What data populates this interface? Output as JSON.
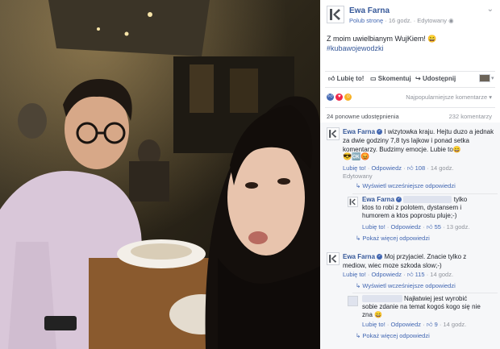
{
  "post": {
    "page_name": "Ewa Farna",
    "follow_label": "Polub stronę",
    "time": "16 godz.",
    "edited": "Edytowany",
    "text": "Z moim uwielbianym WujKiem! 😄",
    "hashtag": "#kubawojewodzki"
  },
  "actions": {
    "like": "Lubię to!",
    "comment": "Skomentuj",
    "share": "Udostępnij"
  },
  "reactions": {
    "sort_label": "Najpopularniejsze komentarze",
    "shares": "24 ponowne udostępnienia",
    "comments_count": "232 komentarzy"
  },
  "comments": [
    {
      "author": "Ewa Farna",
      "text": "I wizytowka kraju. Hejtu duzo a jednak za dwie godziny 7,8 tys lajkow i ponad setka komentarzy. Budzimy emocje. Lubie to😄",
      "emoji_line": "😎🆗😡",
      "like": "Lubię to!",
      "reply": "Odpowiedz",
      "likes": "108",
      "time": "14 godz.",
      "edited": "Edytowany",
      "show_previous": "Wyświetl wcześniejsze odpowiedzi",
      "reply_item": {
        "author": "Ewa Farna",
        "text": "tylko ktos to robi z polotem, dystansem i humorem a ktos poprostu pluje;-)",
        "like": "Lubię to!",
        "reply": "Odpowiedz",
        "likes": "55",
        "time": "13 godz."
      },
      "show_more": "Pokaż więcej odpowiedzi"
    },
    {
      "author": "Ewa Farna",
      "text": "Moj przyjaciel. Znacie tylko z mediow, wiec moze szkoda slow;-)",
      "like": "Lubię to!",
      "reply": "Odpowiedz",
      "likes": "115",
      "time": "14 godz.",
      "show_previous": "Wyświetl wcześniejsze odpowiedzi",
      "reply_item": {
        "text": "Najłatwiej jest wyrobić sobie zdanie na temat kogoś kogo się nie zna 😄",
        "like": "Lubię to!",
        "reply": "Odpowiedz",
        "likes": "9",
        "time": "14 godz."
      },
      "show_more": "Pokaż więcej odpowiedzi"
    }
  ],
  "colors": {
    "link": "#365899",
    "action_blue": "#4267b2",
    "meta_gray": "#90949c"
  }
}
